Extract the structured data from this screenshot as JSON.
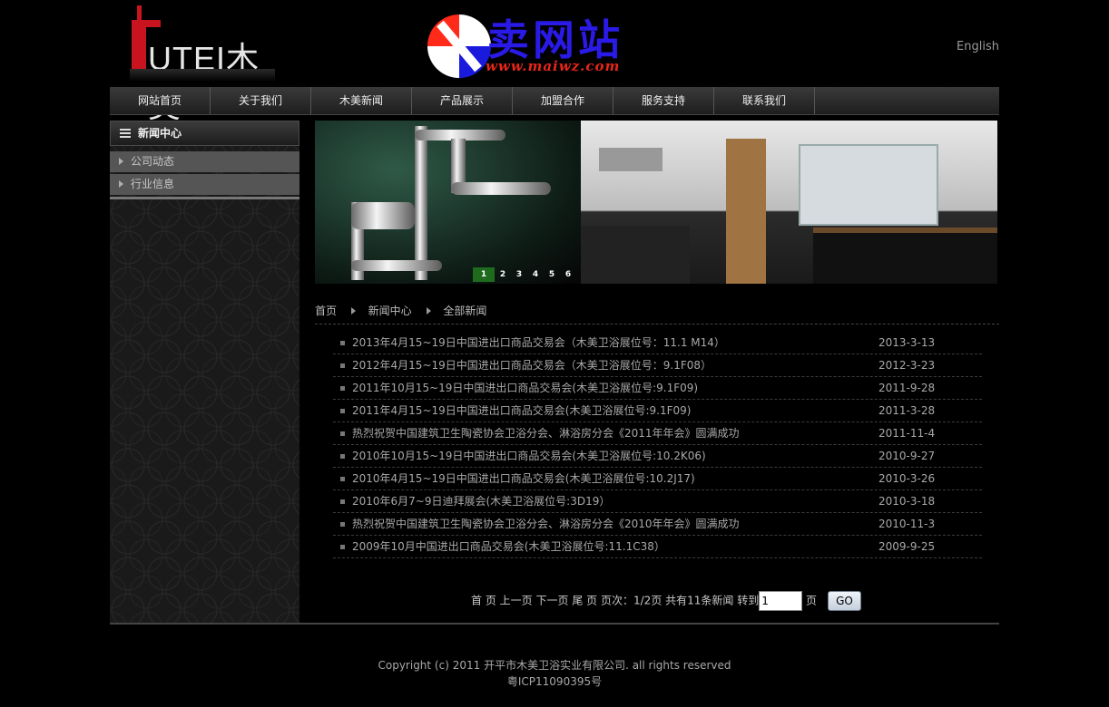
{
  "header": {
    "brand_text": "UTEI木美",
    "watermark_cn": "卖网站",
    "watermark_url": "www.maiwz.com",
    "lang_link": "English"
  },
  "nav": {
    "items": [
      {
        "label": "网站首页"
      },
      {
        "label": "关于我们"
      },
      {
        "label": "木美新闻"
      },
      {
        "label": "产品展示"
      },
      {
        "label": "加盟合作"
      },
      {
        "label": "服务支持"
      },
      {
        "label": "联系我们"
      }
    ]
  },
  "sidebar": {
    "title": "新闻中心",
    "items": [
      {
        "label": "公司动态"
      },
      {
        "label": "行业信息"
      }
    ]
  },
  "slider": {
    "pages": [
      "1",
      "2",
      "3",
      "4",
      "5",
      "6"
    ],
    "active": "1"
  },
  "breadcrumb": {
    "items": [
      "首页",
      "新闻中心",
      "全部新闻"
    ]
  },
  "news": [
    {
      "title": "2013年4月15~19日中国进出口商品交易会（木美卫浴展位号：11.1 M14）",
      "date": "2013-3-13"
    },
    {
      "title": "2012年4月15~19日中国进出口商品交易会（木美卫浴展位号：9.1F08）",
      "date": "2012-3-23"
    },
    {
      "title": "2011年10月15~19日中国进出口商品交易会(木美卫浴展位号:9.1F09)",
      "date": "2011-9-28"
    },
    {
      "title": "2011年4月15~19日中国进出口商品交易会(木美卫浴展位号:9.1F09)",
      "date": "2011-3-28"
    },
    {
      "title": "热烈祝贺中国建筑卫生陶瓷协会卫浴分会、淋浴房分会《2011年年会》圆满成功",
      "date": "2011-11-4"
    },
    {
      "title": "2010年10月15~19日中国进出口商品交易会(木美卫浴展位号:10.2K06)",
      "date": "2010-9-27"
    },
    {
      "title": "2010年4月15~19日中国进出口商品交易会(木美卫浴展位号:10.2J17)",
      "date": "2010-3-26"
    },
    {
      "title": "2010年6月7~9日迪拜展会(木美卫浴展位号:3D19）",
      "date": "2010-3-18"
    },
    {
      "title": "热烈祝贺中国建筑卫生陶瓷协会卫浴分会、淋浴房分会《2010年年会》圆满成功",
      "date": "2010-11-3"
    },
    {
      "title": "2009年10月中国进出口商品交易会(木美卫浴展位号:11.1C38）",
      "date": "2009-9-25"
    }
  ],
  "pager": {
    "first": "首 页",
    "prev": "上一页",
    "next": "下一页",
    "last": "尾 页",
    "info": "页次：1/2页 共有11条新闻 转到",
    "page_value": "1",
    "page_suffix": "页",
    "go_label": "GO"
  },
  "footer": {
    "copyright": "Copyright (c) 2011 开平市木美卫浴实业有限公司. all rights reserved",
    "icp": "粤ICP11090395号"
  }
}
